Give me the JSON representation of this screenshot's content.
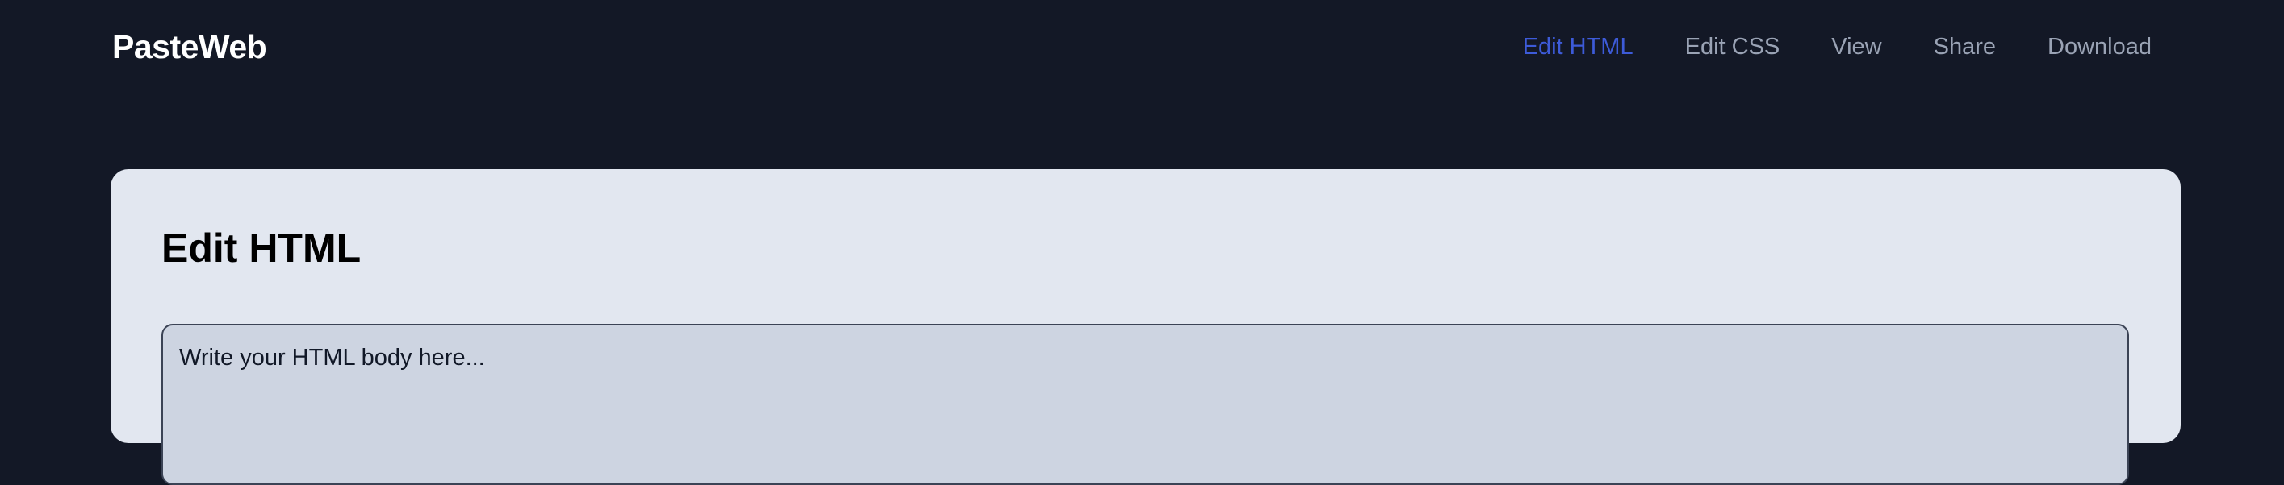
{
  "app": {
    "brand": "PasteWeb"
  },
  "nav": {
    "items": [
      {
        "label": "Edit HTML",
        "active": true
      },
      {
        "label": "Edit CSS",
        "active": false
      },
      {
        "label": "View",
        "active": false
      },
      {
        "label": "Share",
        "active": false
      },
      {
        "label": "Download",
        "active": false
      }
    ]
  },
  "main": {
    "title": "Edit HTML",
    "editor": {
      "value": "",
      "placeholder": "Write your HTML body here..."
    }
  },
  "colors": {
    "background": "#131826",
    "nav_active": "#3d5bd9",
    "nav_inactive": "#9aa3b5",
    "card": "#e2e7f0",
    "editor_bg": "#cdd4e1"
  }
}
